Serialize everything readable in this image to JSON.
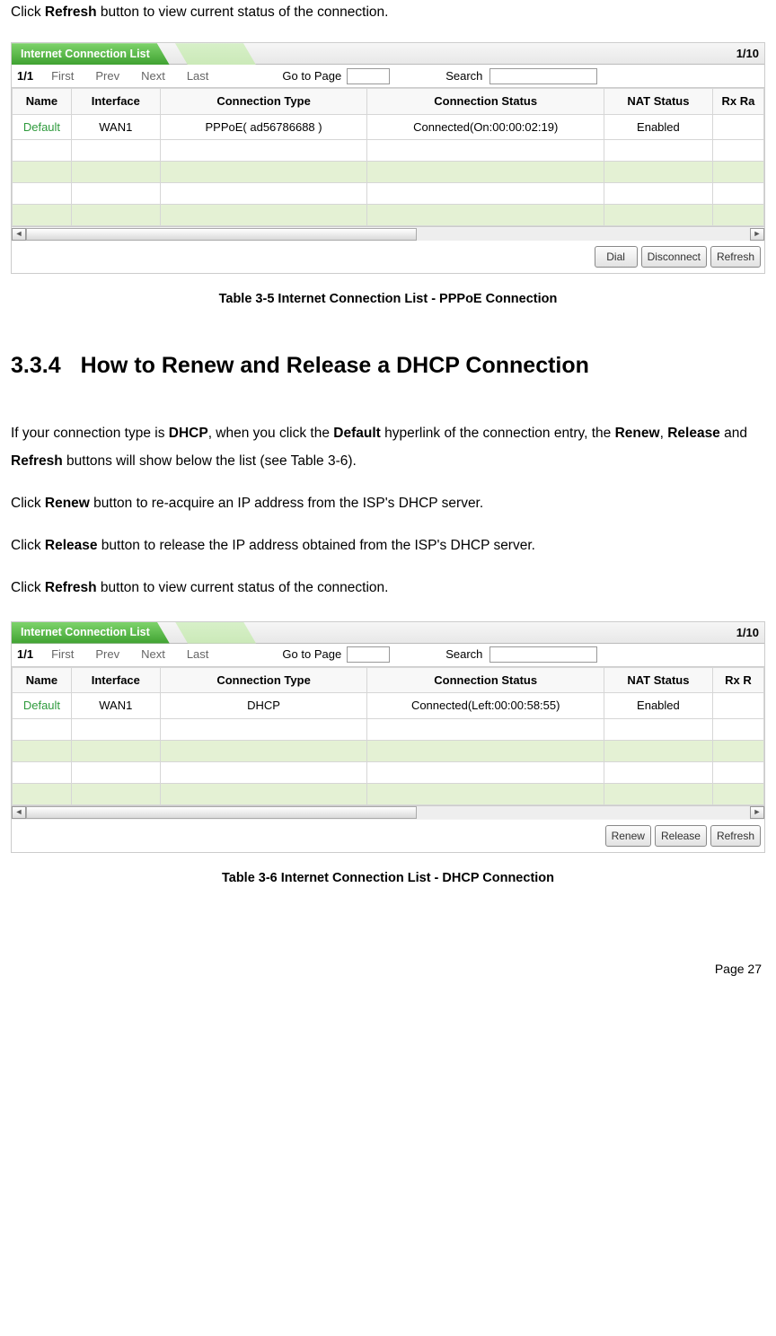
{
  "intro_prefix": "Click ",
  "intro_bold": "Refresh",
  "intro_suffix": " button to view current status of the connection.",
  "panel1": {
    "title": "Internet Connection List",
    "counter": "1/10",
    "toolbar": {
      "page": "1/1",
      "first": "First",
      "prev": "Prev",
      "next": "Next",
      "last": "Last",
      "goto_label": "Go to Page",
      "search_label": "Search"
    },
    "headers": [
      "Name",
      "Interface",
      "Connection Type",
      "Connection Status",
      "NAT Status",
      "Rx Ra"
    ],
    "row": {
      "name": "Default",
      "interface": "WAN1",
      "type": "PPPoE( ad56786688 )",
      "status": "Connected(On:00:00:02:19)",
      "nat": "Enabled"
    },
    "buttons": [
      "Dial",
      "Disconnect",
      "Refresh"
    ]
  },
  "caption1": "Table 3-5 Internet Connection List - PPPoE Connection",
  "section": {
    "num": "3.3.4",
    "title": "How to Renew and Release a DHCP Connection"
  },
  "para1_a": "If your connection type is ",
  "para1_b": "DHCP",
  "para1_c": ", when you click the ",
  "para1_d": "Default",
  "para1_e": " hyperlink of the connection entry, the ",
  "para1_f": "Renew",
  "para1_g": ", ",
  "para1_h": "Release",
  "para1_i": " and ",
  "para1_j": "Refresh",
  "para1_k": " buttons will show below the list (see Table 3-6).",
  "para2_a": "Click ",
  "para2_b": "Renew",
  "para2_c": " button to re-acquire an IP address from the ISP's DHCP server.",
  "para3_a": "Click ",
  "para3_b": "Release",
  "para3_c": " button to release the IP address obtained from the ISP's DHCP server.",
  "para4_a": "Click ",
  "para4_b": "Refresh",
  "para4_c": " button to view current status of the connection.",
  "panel2": {
    "title": "Internet Connection List",
    "counter": "1/10",
    "toolbar": {
      "page": "1/1",
      "first": "First",
      "prev": "Prev",
      "next": "Next",
      "last": "Last",
      "goto_label": "Go to Page",
      "search_label": "Search"
    },
    "headers": [
      "Name",
      "Interface",
      "Connection Type",
      "Connection Status",
      "NAT Status",
      "Rx R"
    ],
    "row": {
      "name": "Default",
      "interface": "WAN1",
      "type": "DHCP",
      "status": "Connected(Left:00:00:58:55)",
      "nat": "Enabled"
    },
    "buttons": [
      "Renew",
      "Release",
      "Refresh"
    ]
  },
  "caption2": "Table 3-6 Internet Connection List - DHCP Connection",
  "page_number": "Page 27"
}
